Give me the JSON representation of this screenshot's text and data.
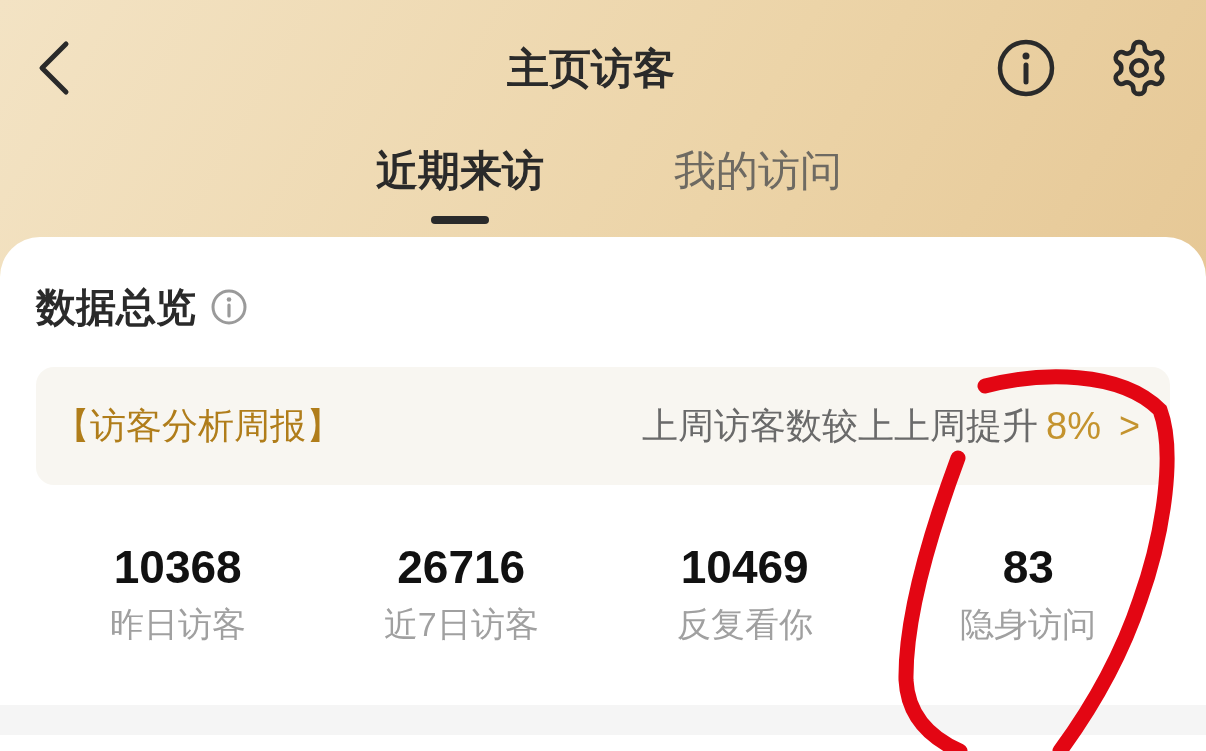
{
  "header": {
    "title": "主页访客"
  },
  "tabs": [
    {
      "label": "近期来访",
      "selected": true
    },
    {
      "label": "我的访问",
      "selected": false
    }
  ],
  "overview": {
    "title": "数据总览",
    "report": {
      "label": "【访客分析周报】",
      "text": "上周访客数较上上周提升",
      "percent": "8%",
      "chevron": ">"
    },
    "stats": [
      {
        "value": "10368",
        "label": "昨日访客"
      },
      {
        "value": "26716",
        "label": "近7日访客"
      },
      {
        "value": "10469",
        "label": "反复看你"
      },
      {
        "value": "83",
        "label": "隐身访问"
      }
    ]
  },
  "annotation": {
    "kind": "red-circle"
  }
}
